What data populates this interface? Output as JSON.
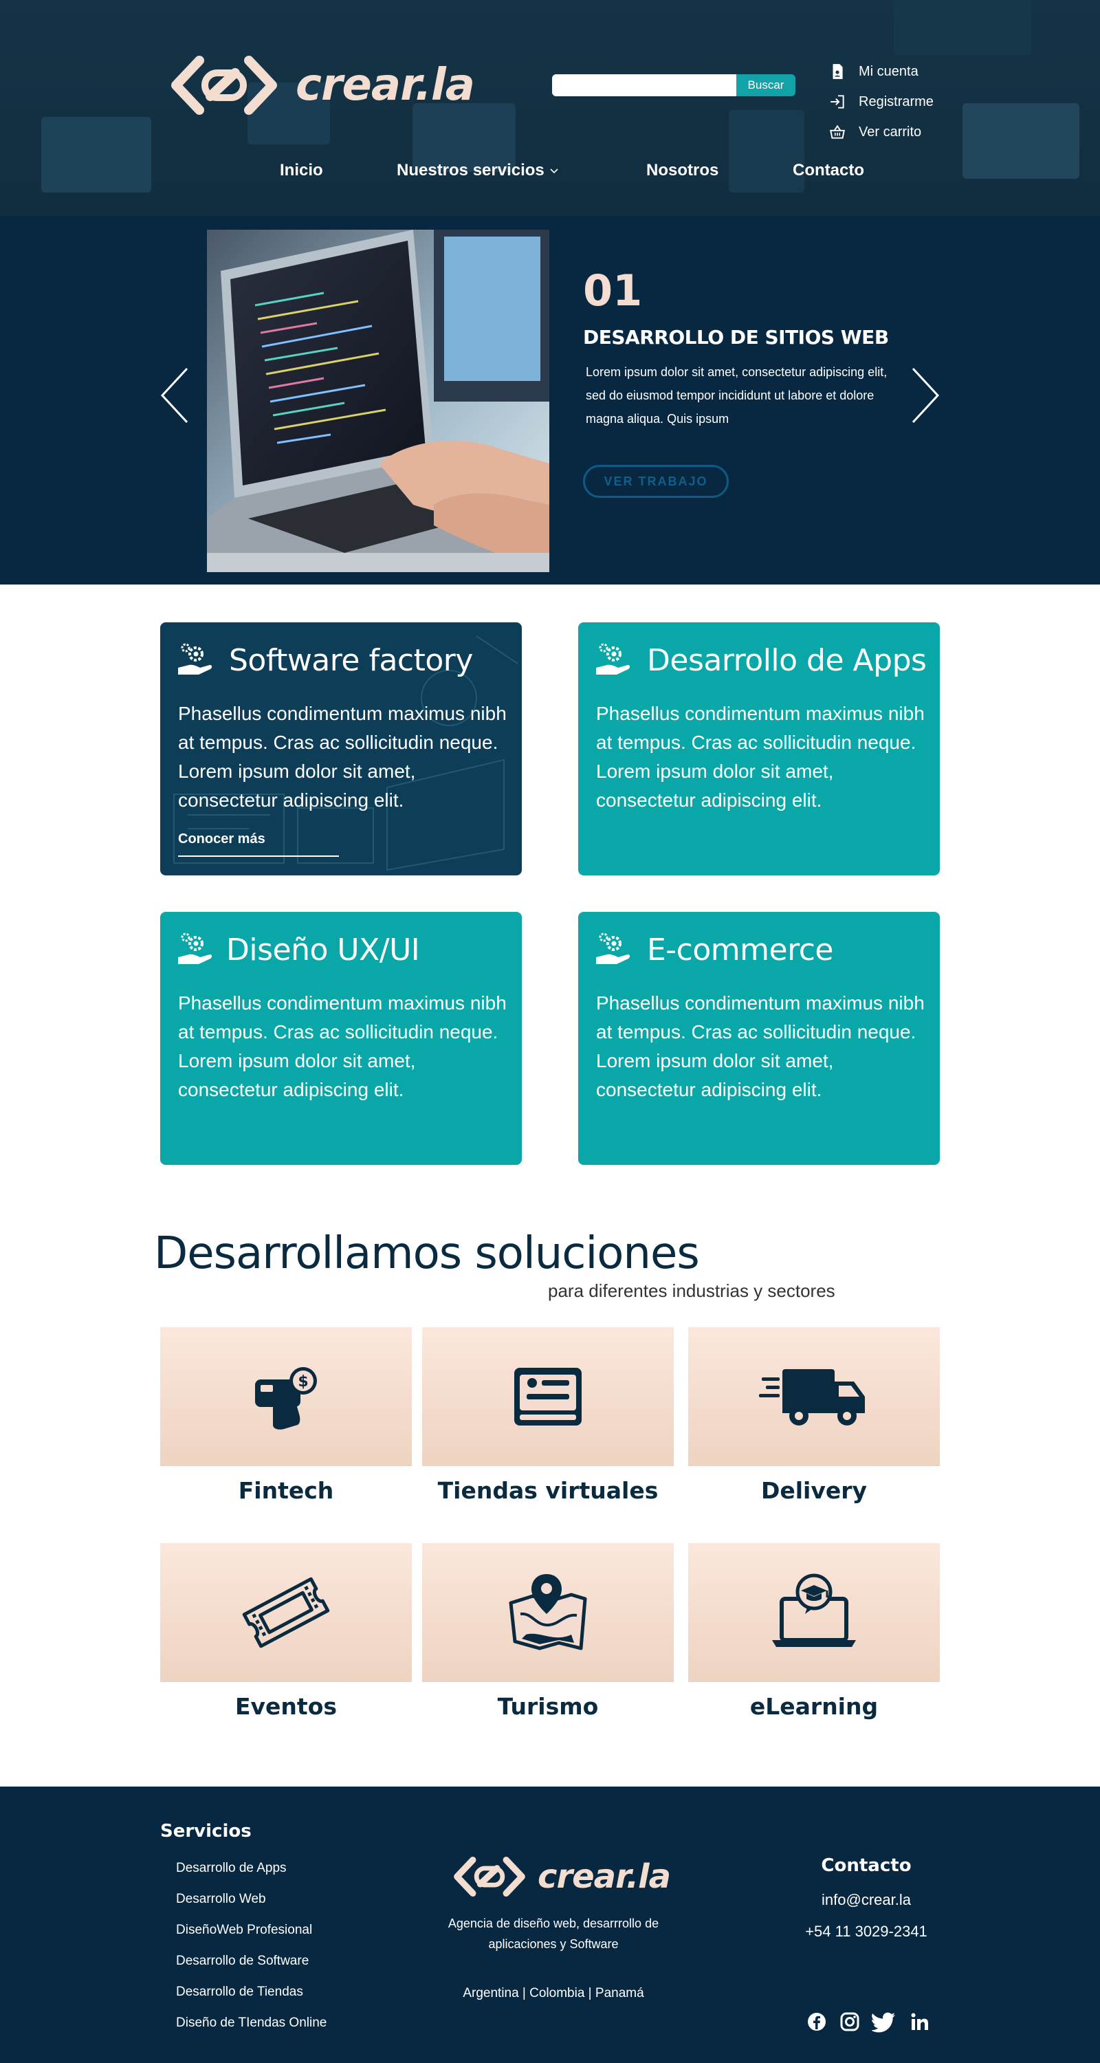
{
  "header": {
    "brand": "crear.la",
    "search": {
      "placeholder": "",
      "button_label": "Buscar"
    },
    "account_links": [
      "Mi cuenta",
      "Registrarme",
      "Ver carrito"
    ],
    "nav": [
      "Inicio",
      "Nuestros servicios",
      "Nosotros",
      "Contacto"
    ]
  },
  "hero": {
    "number": "01",
    "title": "DESARROLLO DE SITIOS WEB",
    "text": "Lorem ipsum dolor sit amet, consectetur adipiscing elit, sed do eiusmod tempor incididunt ut labore et dolore magna aliqua. Quis ipsum",
    "button_label": "VER TRABAJO"
  },
  "services": [
    {
      "title": "Software factory",
      "text": "Phasellus condimentum maximus nibh at tempus. Cras ac sollicitudin neque. Lorem ipsum dolor sit amet, consectetur adipiscing elit.",
      "link": "Conocer más"
    },
    {
      "title": "Desarrollo de Apps",
      "text": "Phasellus condimentum maximus nibh at tempus. Cras ac sollicitudin neque. Lorem ipsum dolor sit amet, consectetur adipiscing elit."
    },
    {
      "title": "Diseño UX/UI",
      "text": "Phasellus condimentum maximus nibh at tempus. Cras ac sollicitudin neque. Lorem ipsum dolor sit amet, consectetur adipiscing elit."
    },
    {
      "title": "E-commerce",
      "text": "Phasellus condimentum maximus nibh at tempus. Cras ac sollicitudin neque. Lorem ipsum dolor sit amet, consectetur adipiscing elit."
    }
  ],
  "solutions": {
    "title": "Desarrollamos soluciones",
    "subtitle": "para diferentes industrias y sectores",
    "items": [
      {
        "label": "Fintech",
        "icon": "fintech-payment-icon"
      },
      {
        "label": "Tiendas virtuales",
        "icon": "online-store-card-icon"
      },
      {
        "label": "Delivery",
        "icon": "delivery-truck-icon"
      },
      {
        "label": "Eventos",
        "icon": "event-ticket-icon"
      },
      {
        "label": "Turismo",
        "icon": "tourism-map-icon"
      },
      {
        "label": "eLearning",
        "icon": "elearning-laptop-icon"
      }
    ]
  },
  "footer": {
    "services_title": "Servicios",
    "services": [
      "Desarrollo de Apps",
      "Desarrollo Web",
      "DiseñoWeb Profesional",
      "Desarrollo de Software",
      "Desarrollo de Tiendas",
      "Diseño de TIendas Online"
    ],
    "brand": "crear.la",
    "tagline": "Agencia de diseño web, desarrrollo de aplicaciones y Software",
    "countries": "Argentina  |  Colombia  |  Panamá",
    "contact_title": "Contacto",
    "email": "info@crear.la",
    "phone": "+54 11 3029-2341",
    "social": [
      "facebook-icon",
      "instagram-icon",
      "twitter-icon",
      "linkedin-icon"
    ]
  },
  "colors": {
    "navy": "#072840",
    "teal": "#0aa7a8",
    "peach": "#f4ddd0",
    "button_teal": "#11a3a8"
  }
}
